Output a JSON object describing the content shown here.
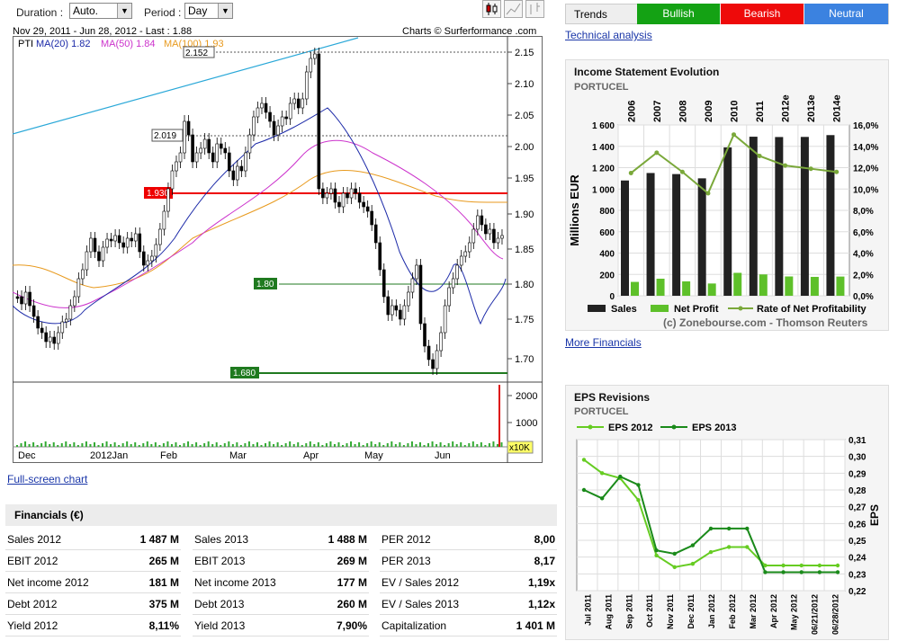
{
  "toolbar": {
    "duration_label": "Duration :",
    "duration_value": "Auto.",
    "period_label": "Period :",
    "period_value": "Day"
  },
  "chart": {
    "header_left": "Nov 29, 2011 - Jun 28, 2012 - Last : 1.88",
    "header_right": "Charts © Surferformance .com",
    "legend_pti": "PTI",
    "legend_ma20": "MA(20) 1.82",
    "legend_ma50": "MA(50) 1.84",
    "legend_ma100": "MA(100) 1.93",
    "price_ticks": [
      "2.15",
      "2.10",
      "2.05",
      "2.00",
      "1.95",
      "1.90",
      "1.85",
      "1.80",
      "1.75",
      "1.70"
    ],
    "volume_ticks": [
      "2000",
      "1000"
    ],
    "volume_unit": "x10K",
    "month_labels": [
      "Dec",
      "2012Jan",
      "Feb",
      "Mar",
      "Apr",
      "May",
      "Jun"
    ],
    "level_2152": "2.152",
    "level_2019": "2.019",
    "level_1930": "1.930",
    "level_180": "1.80",
    "level_1680": "1.680",
    "colors": {
      "ma20": "#1c2aa8",
      "ma50": "#cc33cc",
      "ma100": "#e89a1e",
      "trend": "#2aa8d8",
      "resist": "#ee0000",
      "support": "#1f7a1f"
    }
  },
  "links": {
    "fullscreen": "Full-screen chart",
    "technical": "Technical analysis",
    "more_financials": "More Financials"
  },
  "trends": {
    "label": "Trends",
    "bullish": "Bullish",
    "bearish": "Bearish",
    "neutral": "Neutral",
    "colors": {
      "bullish": "#14a214",
      "bearish": "#ee0a0a",
      "neutral": "#3b82e0"
    }
  },
  "income": {
    "title": "Income Statement Evolution",
    "company": "PORTUCEL",
    "ylabel": "Millions EUR",
    "y_left_ticks": [
      "1 600",
      "1 400",
      "1 200",
      "1 000",
      "800",
      "600",
      "400",
      "200",
      "0"
    ],
    "y_right_ticks": [
      "16,0%",
      "14,0%",
      "12,0%",
      "10,0%",
      "8,0%",
      "6,0%",
      "4,0%",
      "2,0%",
      "0,0%"
    ],
    "legend_sales": "Sales",
    "legend_net": "Net Profit",
    "legend_rate": "Rate of Net Profitability",
    "credit": "(c) Zonebourse.com - Thomson Reuters"
  },
  "eps": {
    "title": "EPS Revisions",
    "company": "PORTUCEL",
    "legend_2012": "EPS 2012",
    "legend_2013": "EPS 2013",
    "ylabel": "EPS",
    "y_ticks": [
      "0,31",
      "0,30",
      "0,29",
      "0,28",
      "0,27",
      "0,26",
      "0,25",
      "0,24",
      "0,23",
      "0,22"
    ]
  },
  "financials": {
    "title": "Financials (€)",
    "rows": [
      [
        {
          "l": "Sales 2012",
          "v": "1 487 M"
        },
        {
          "l": "Sales 2013",
          "v": "1 488 M"
        },
        {
          "l": "PER 2012",
          "v": "8,00"
        }
      ],
      [
        {
          "l": "EBIT 2012",
          "v": "265 M"
        },
        {
          "l": "EBIT 2013",
          "v": "269 M"
        },
        {
          "l": "PER 2013",
          "v": "8,17"
        }
      ],
      [
        {
          "l": "Net income 2012",
          "v": "181 M"
        },
        {
          "l": "Net income 2013",
          "v": "177 M"
        },
        {
          "l": "EV / Sales 2012",
          "v": "1,19x"
        }
      ],
      [
        {
          "l": "Debt 2012",
          "v": "375 M"
        },
        {
          "l": "Debt 2013",
          "v": "260 M"
        },
        {
          "l": "EV / Sales 2013",
          "v": "1,12x"
        }
      ],
      [
        {
          "l": "Yield 2012",
          "v": "8,11%"
        },
        {
          "l": "Yield 2013",
          "v": "7,90%"
        },
        {
          "l": "Capitalization",
          "v": "1 401 M"
        }
      ]
    ]
  },
  "chart_data": [
    {
      "type": "bar",
      "title": "Income Statement Evolution",
      "categories": [
        "2006",
        "2007",
        "2008",
        "2009",
        "2010",
        "2011",
        "2012e",
        "2013e",
        "2014e"
      ],
      "ylabel": "Millions EUR",
      "ylim": [
        0,
        1600
      ],
      "y2lim": [
        0,
        16
      ],
      "series": [
        {
          "name": "Sales",
          "values": [
            1080,
            1150,
            1140,
            1100,
            1390,
            1490,
            1487,
            1488,
            1505
          ],
          "color": "#222222"
        },
        {
          "name": "Net Profit",
          "values": [
            130,
            160,
            135,
            115,
            215,
            200,
            181,
            177,
            180
          ],
          "color": "#5ec02a"
        },
        {
          "name": "Rate of Net Profitability",
          "values": [
            11.5,
            13.4,
            11.6,
            9.6,
            15.1,
            13.1,
            12.2,
            11.9,
            11.6
          ],
          "type": "line",
          "color": "#7aa83a"
        }
      ]
    },
    {
      "type": "line",
      "title": "EPS Revisions",
      "categories": [
        "Jul 2011",
        "Aug 2011",
        "Sep 2011",
        "Oct 2011",
        "Nov 2011",
        "Dec 2011",
        "Jan 2012",
        "Feb 2012",
        "Mar 2012",
        "Apr 2012",
        "May 2012",
        "06/21/2012",
        "06/28/2012"
      ],
      "ylabel": "EPS",
      "ylim": [
        0.22,
        0.31
      ],
      "series": [
        {
          "name": "EPS 2012",
          "values": [
            0.298,
            0.29,
            0.287,
            0.274,
            0.241,
            0.234,
            0.236,
            0.243,
            0.246,
            0.246,
            0.235,
            0.235,
            0.235,
            0.235,
            0.235
          ],
          "color": "#66cc22"
        },
        {
          "name": "EPS 2013",
          "values": [
            0.28,
            0.275,
            0.288,
            0.283,
            0.244,
            0.242,
            0.247,
            0.257,
            0.257,
            0.257,
            0.231,
            0.231,
            0.231,
            0.231,
            0.231
          ],
          "color": "#1a8a1a"
        }
      ]
    }
  ]
}
